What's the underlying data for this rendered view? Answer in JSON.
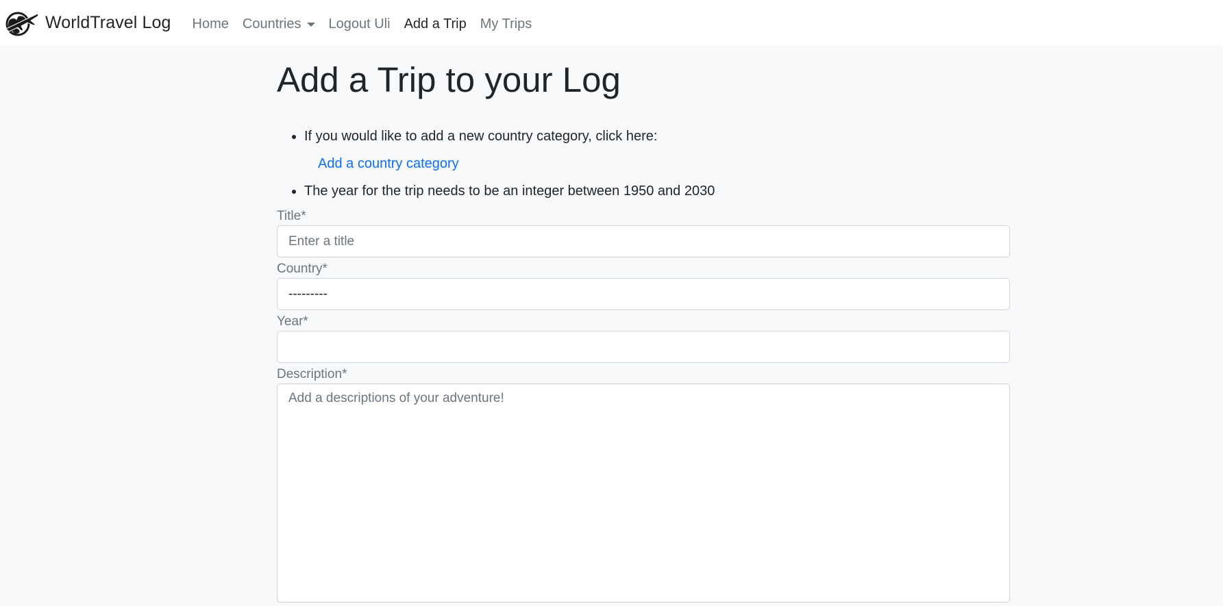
{
  "navbar": {
    "brand": "WorldTravel Log",
    "links": {
      "home": "Home",
      "countries": "Countries",
      "logout": "Logout Uli",
      "add_trip": "Add a Trip",
      "my_trips": "My Trips"
    },
    "active": "add_trip"
  },
  "page": {
    "title": "Add a Trip to your Log",
    "notes": {
      "category_note": "If you would like to add a new country category, click here:",
      "category_link": "Add a country category",
      "year_note": "The year for the trip needs to be an integer between 1950 and 2030"
    }
  },
  "form": {
    "title": {
      "label": "Title*",
      "placeholder": "Enter a title",
      "value": ""
    },
    "country": {
      "label": "Country*",
      "selected": "---------"
    },
    "year": {
      "label": "Year*",
      "value": ""
    },
    "description": {
      "label": "Description*",
      "placeholder": "Add a descriptions of your adventure!",
      "value": ""
    }
  },
  "colors": {
    "background": "#f8f9fa",
    "navbar": "#ffffff",
    "link": "#0d6efd",
    "muted": "#6c757d",
    "text": "#212529"
  },
  "icons": {
    "brand_logo": "globe-airplane-icon",
    "countries_dropdown": "caret-down-icon"
  }
}
